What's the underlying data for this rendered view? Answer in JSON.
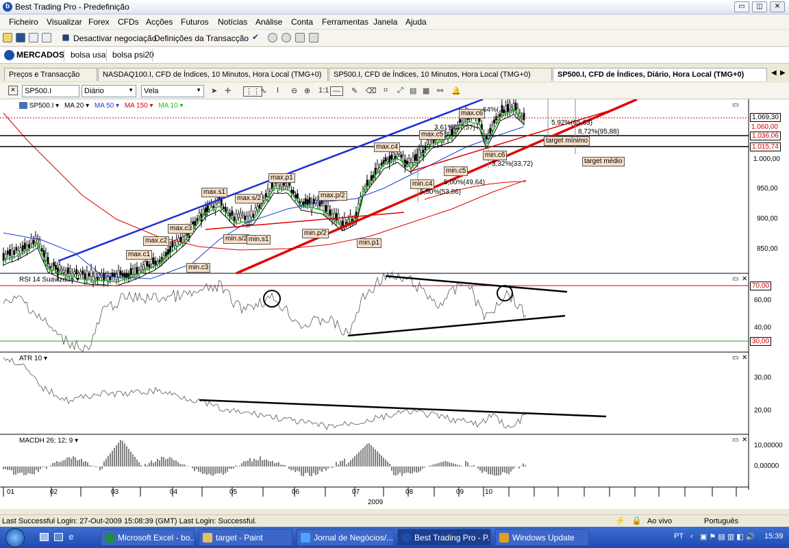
{
  "window": {
    "title": "Best Trading Pro - Predefinição",
    "app_icon_letter": "b",
    "buttons": [
      "▭",
      "◫",
      "✕"
    ]
  },
  "menu": [
    "Ficheiro",
    "Visualizar",
    "Forex",
    "CFDs",
    "Acções",
    "Futuros",
    "Notícias",
    "Análise",
    "Conta",
    "Ferramentas",
    "Janela",
    "Ajuda"
  ],
  "toolbar": {
    "deactivate": "Desactivar negociação",
    "settings": "Definições da Transacção"
  },
  "workspace_tabs": [
    "MERCADOS",
    "bolsa usa",
    "bolsa psi20"
  ],
  "doc_tabs": [
    "Preços e Transacção",
    "NASDAQ100.I, CFD de Índices, 10 Minutos, Hora Local (TMG+0)",
    "SP500.I, CFD de Índices, 10 Minutos, Hora Local (TMG+0)",
    "SP500.I, CFD de Índices, Diário, Hora Local (TMG+0)"
  ],
  "chart_toolbar": {
    "symbol": "SP500.I",
    "period": "Diário",
    "style": "Vela",
    "ratio": "1:1"
  },
  "main_panel": {
    "legend": [
      "SP500.I ▾",
      "MA 20 ▾",
      "MA 50 ▾",
      "MA 150 ▾",
      "MA 10 ▾"
    ],
    "legend_colors": [
      "#000000",
      "#000000",
      "#1f3fd0",
      "#e00000",
      "#17c017"
    ],
    "price_ticks": [
      "1.000,00",
      "950,00",
      "900,00",
      "850,00"
    ],
    "price_boxes": [
      "1.069,30",
      "1.060,00",
      "1.036,06",
      "1.015,74"
    ],
    "annotations": [
      "max.s1",
      "max.s/2",
      "max.p1",
      "max.p/2",
      "max.c1",
      "max.c2",
      "max.c3",
      "max.c4",
      "max.c5",
      "max.c6",
      "min.s/2",
      "min.s1",
      "min.p/2",
      "min.p1",
      "min.c3",
      "min.c4",
      "min.c5",
      "min.c6",
      "target mínimo",
      "target médio"
    ],
    "measures": [
      "5,50%(53,86)",
      "5,00%(49,64)",
      "3,61%(37,57)",
      "64%(",
      "5,92%(65,63)",
      "8,72%(95,88)",
      "3,32%(33,72)"
    ]
  },
  "rsi_panel": {
    "label": "RSI 14 Suavizado ▾",
    "ticks": [
      "60,00",
      "40,00"
    ],
    "levels": [
      "70,00",
      "30,00"
    ]
  },
  "atr_panel": {
    "label": "ATR 10 ▾",
    "ticks": [
      "30,00",
      "20,00"
    ]
  },
  "macd_panel": {
    "label": "MACDH 26; 12; 9 ▾",
    "ticks": [
      "10,00000",
      "0,00000"
    ]
  },
  "time_axis": {
    "months": [
      "01",
      "02",
      "03",
      "04",
      "05",
      "06",
      "07",
      "08",
      "09",
      "10"
    ],
    "year": "2009"
  },
  "status": {
    "login": "Last Successful Login: 27-Out-2009 15:08:39 (GMT)   Last Login: Successful.",
    "live": "Ao vivo",
    "language": "Português"
  },
  "taskbar": {
    "tasks": [
      "Microsoft Excel - bo...",
      "target - Paint",
      "Jornal de Negócios/...",
      "Best Trading Pro - P...",
      "Windows Update"
    ],
    "lang": "PT",
    "clock": "15:39"
  }
}
